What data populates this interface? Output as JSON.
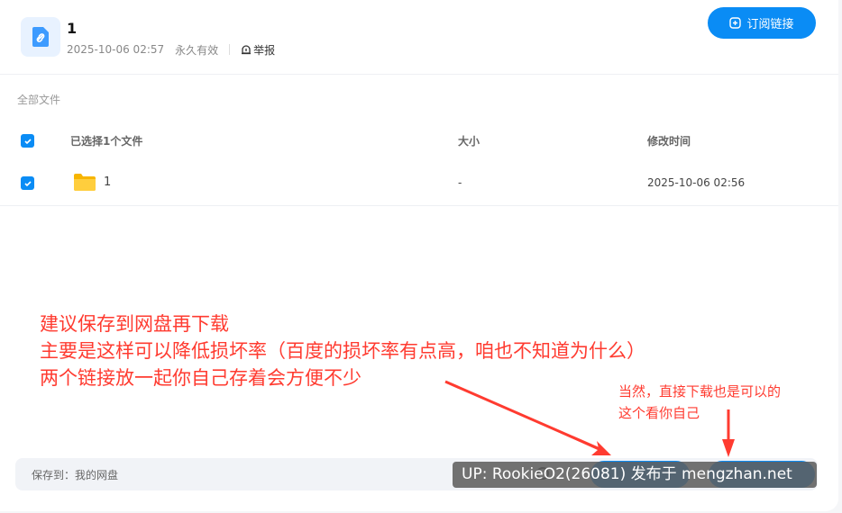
{
  "share": {
    "title": "1",
    "date": "2025-10-06 02:57",
    "validity": "永久有效",
    "report_label": "举报",
    "subscribe_label": "订阅链接"
  },
  "breadcrumb": "全部文件",
  "table": {
    "headers": [
      "已选择1个文件",
      "大小",
      "修改时间"
    ],
    "rows": [
      {
        "name": "1",
        "size": "-",
        "modified": "2025-10-06 02:56"
      }
    ]
  },
  "annotations": {
    "main_lines": [
      "建议保存到网盘再下载",
      "主要是这样可以降低损坏率（百度的损坏率有点高，咱也不知道为什么）",
      "两个链接放一起你自己存着会方便不少"
    ],
    "side_lines": [
      "当然，直接下载也是可以的",
      "这个看你自己"
    ]
  },
  "save_bar": {
    "label": "保存到：我的网盘"
  },
  "watermark": "UP: RookieO2(26081) 发布于 mengzhan.net",
  "colors": {
    "accent": "#0a8cf5",
    "annotation_red": "#ff3b30"
  },
  "icons": [
    "link-icon",
    "report-icon",
    "plus-square-icon",
    "check-icon",
    "folder-icon"
  ]
}
